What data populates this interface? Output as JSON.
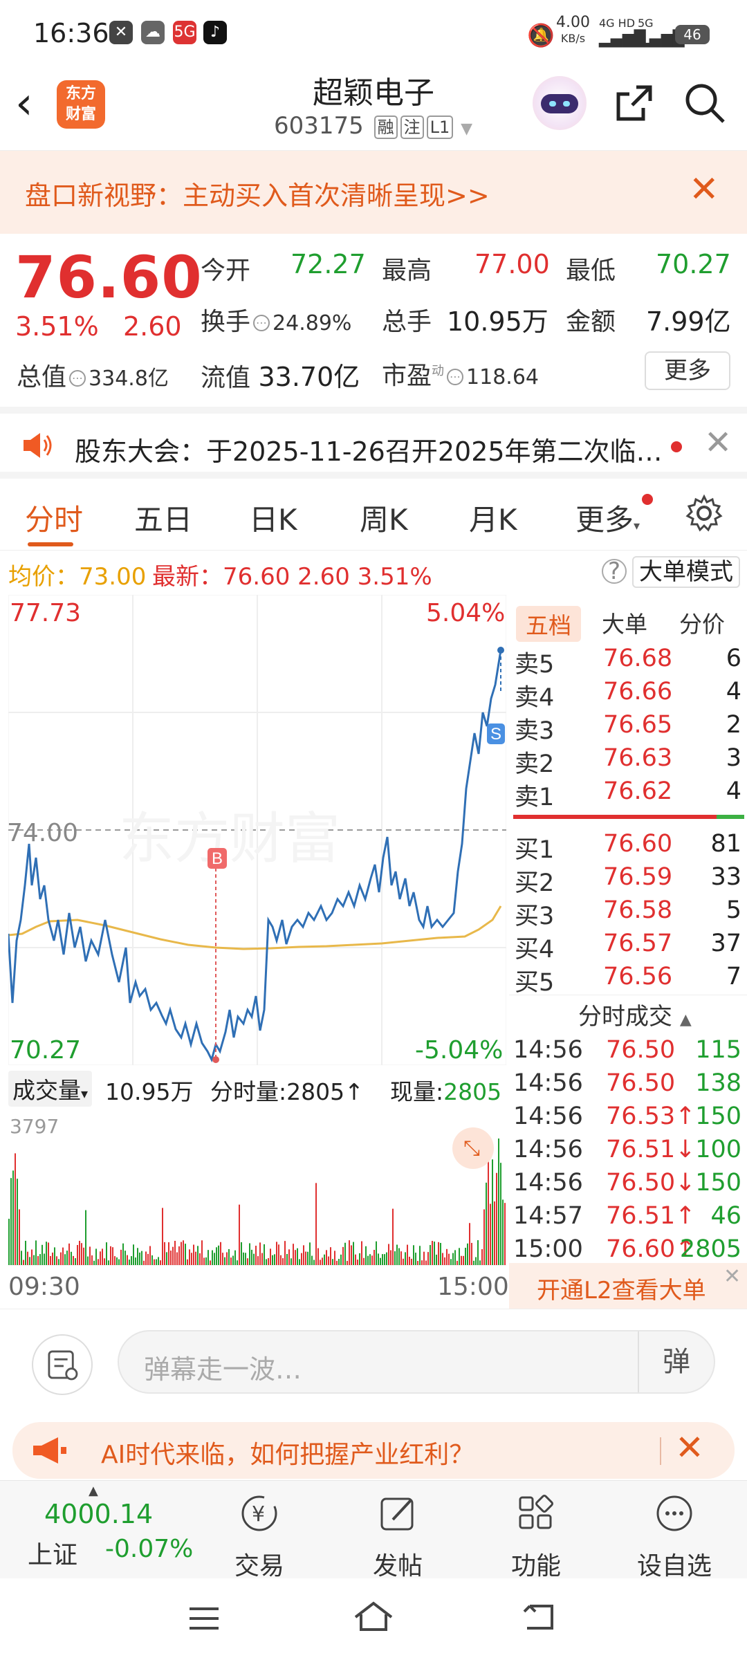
{
  "status_bar": {
    "time": "16:36",
    "speed_value": "4.00",
    "speed_unit": "KB/s",
    "net1": "4G HD",
    "net2": "5G",
    "battery": "46"
  },
  "header": {
    "stock_name": "超颖电子",
    "stock_code": "603175",
    "tags": [
      "融",
      "注",
      "L1"
    ],
    "logo_line1": "东方",
    "logo_line2": "财富"
  },
  "banner": {
    "text": "盘口新视野：主动买入首次清晰呈现>>"
  },
  "quote": {
    "price": "76.60",
    "change_pct": "3.51%",
    "change": "2.60",
    "open_label": "今开",
    "open": "72.27",
    "high_label": "最高",
    "high": "77.00",
    "low_label": "最低",
    "low": "70.27",
    "turnover_label": "换手",
    "turnover": "24.89%",
    "volume_label": "总手",
    "volume": "10.95万",
    "amount_label": "金额",
    "amount": "7.99亿",
    "total_cap_label": "总值",
    "total_cap": "334.8亿",
    "float_cap_label": "流值",
    "float_cap": "33.70亿",
    "pe_label": "市盈",
    "pe_sup": "动",
    "pe": "118.64",
    "more_label": "更多"
  },
  "notice": {
    "text": "股东大会：于2025-11-26召开2025年第二次临…"
  },
  "tabs": [
    "分时",
    "五日",
    "日K",
    "周K",
    "月K",
    "更多"
  ],
  "avg_bar": {
    "avg_label": "均价：",
    "avg": "73.00",
    "latest_label": "最新：",
    "latest": "76.60",
    "change": "2.60",
    "pct": "3.51%",
    "mode_button": "大单模式",
    "help": "?"
  },
  "chart": {
    "y_top": "77.73",
    "y_top_pct": "5.04%",
    "y_mid": "74.00",
    "y_bottom": "70.27",
    "y_bottom_pct": "-5.04%",
    "marker_buy": "B",
    "marker_sell": "S",
    "watermark": "东方财富",
    "time_start": "09:30",
    "time_end": "15:00"
  },
  "volume_bar": {
    "label": "成交量",
    "total": "10.95万",
    "minute_label": "分时量:2805",
    "arrow": "↑",
    "current_label": "现量:",
    "current": "2805",
    "max": "3797"
  },
  "order_book": {
    "tabs": [
      "五档",
      "大单",
      "分价"
    ],
    "asks": [
      {
        "label": "卖5",
        "price": "76.68",
        "vol": "6"
      },
      {
        "label": "卖4",
        "price": "76.66",
        "vol": "4"
      },
      {
        "label": "卖3",
        "price": "76.65",
        "vol": "2"
      },
      {
        "label": "卖2",
        "price": "76.63",
        "vol": "3"
      },
      {
        "label": "卖1",
        "price": "76.62",
        "vol": "4"
      }
    ],
    "bids": [
      {
        "label": "买1",
        "price": "76.60",
        "vol": "81"
      },
      {
        "label": "买2",
        "price": "76.59",
        "vol": "33"
      },
      {
        "label": "买3",
        "price": "76.58",
        "vol": "5"
      },
      {
        "label": "买4",
        "price": "76.57",
        "vol": "37"
      },
      {
        "label": "买5",
        "price": "76.56",
        "vol": "7"
      }
    ],
    "trades_title": "分时成交",
    "trades": [
      {
        "time": "14:56",
        "price": "76.50",
        "vol": "115"
      },
      {
        "time": "14:56",
        "price": "76.50",
        "vol": "138"
      },
      {
        "time": "14:56",
        "price": "76.53↑",
        "vol": "150"
      },
      {
        "time": "14:56",
        "price": "76.51↓",
        "vol": "100"
      },
      {
        "time": "14:56",
        "price": "76.50↓",
        "vol": "150"
      },
      {
        "time": "14:57",
        "price": "76.51↑",
        "vol": "46"
      },
      {
        "time": "15:00",
        "price": "76.60↑",
        "vol": "2805"
      }
    ],
    "l2_text": "开通L2查看大单"
  },
  "comment": {
    "placeholder": "弹幕走一波…",
    "send": "弹"
  },
  "ad": {
    "text": "AI时代来临，如何把握产业红利？"
  },
  "bottom_nav": {
    "index_value": "4000.14",
    "index_name": "上证",
    "index_change": "-0.07%",
    "items": [
      "交易",
      "发帖",
      "功能",
      "设自选"
    ]
  },
  "colors": {
    "up": "#e02f2f",
    "down": "#1f9e2f",
    "accent": "#e05a1c",
    "price_line": "#2f6fb5",
    "avg_line": "#e8b84a"
  }
}
